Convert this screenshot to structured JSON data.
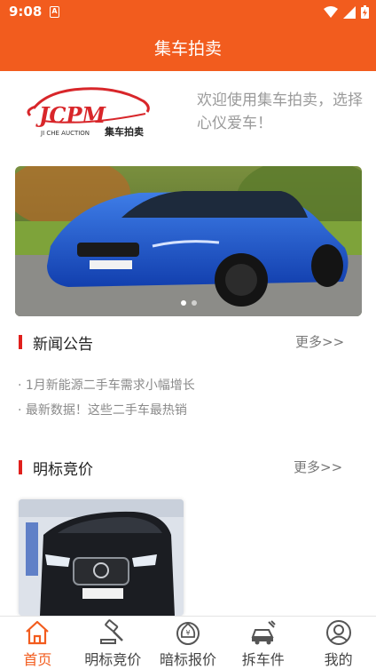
{
  "status_bar": {
    "time": "9:08",
    "sim_label": "A"
  },
  "app_bar": {
    "title": "集车拍卖"
  },
  "logo": {
    "brand_text": "JCPM",
    "sub_text": "JI CHE AUCTION",
    "cn_text": "集车拍卖"
  },
  "welcome": {
    "text": "欢迎使用集车拍卖，选择心仪爱车！"
  },
  "banner": {
    "slide_count": 2,
    "active_index": 0
  },
  "news": {
    "title": "新闻公告",
    "more": "更多>>",
    "items": [
      "· 1月新能源二手车需求小幅增长",
      "· 最新数据！这些二手车最热销"
    ]
  },
  "bidding": {
    "title": "明标竞价",
    "more": "更多>>"
  },
  "tabs": [
    {
      "label": "首页",
      "icon": "home-icon",
      "active": true
    },
    {
      "label": "明标竞价",
      "icon": "gavel-icon",
      "active": false
    },
    {
      "label": "暗标报价",
      "icon": "money-bag-icon",
      "active": false
    },
    {
      "label": "拆车件",
      "icon": "car-parts-icon",
      "active": false
    },
    {
      "label": "我的",
      "icon": "user-icon",
      "active": false
    }
  ],
  "colors": {
    "primary": "#f25c1e",
    "accent_bar": "#e0201c",
    "muted_text": "#9a9a9a"
  }
}
